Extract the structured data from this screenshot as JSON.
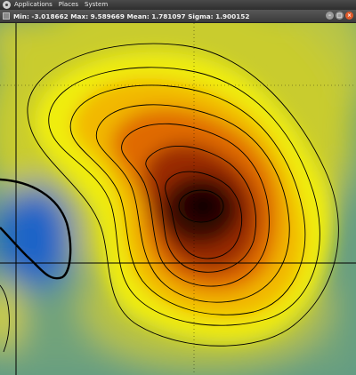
{
  "panel": {
    "menus": [
      "Applications",
      "Places",
      "System"
    ]
  },
  "window": {
    "title": "Min: -3.018662 Max: 9.589669 Mean: 1.781097 Sigma: 1.900152"
  },
  "colors": {
    "low": "#1a64c8",
    "mid_low": "#5a9a8c",
    "mid": "#e4e000",
    "mid_high": "#f0a000",
    "high": "#c85000",
    "peak": "#1a0000",
    "contour": "#000000",
    "crosshair": "#000000"
  },
  "icons": [
    "ubuntu-logo-icon",
    "window-menu-icon",
    "minimize-icon",
    "maximize-icon",
    "close-icon"
  ]
}
